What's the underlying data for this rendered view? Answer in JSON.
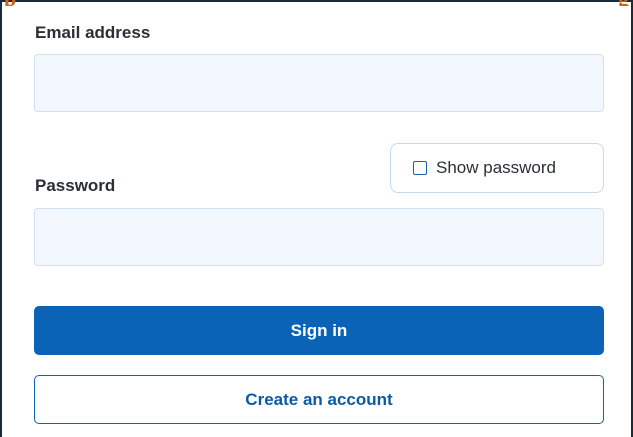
{
  "email": {
    "label": "Email address",
    "value": "",
    "placeholder": ""
  },
  "password": {
    "label": "Password",
    "value": "",
    "placeholder": "",
    "show_password_label": "Show password",
    "show_password_checked": false
  },
  "actions": {
    "sign_in_label": "Sign in",
    "create_account_label": "Create an account"
  },
  "colors": {
    "primary": "#0a63b6",
    "field_bg": "#f1f7fd",
    "heading_orange": "#c8671a"
  }
}
